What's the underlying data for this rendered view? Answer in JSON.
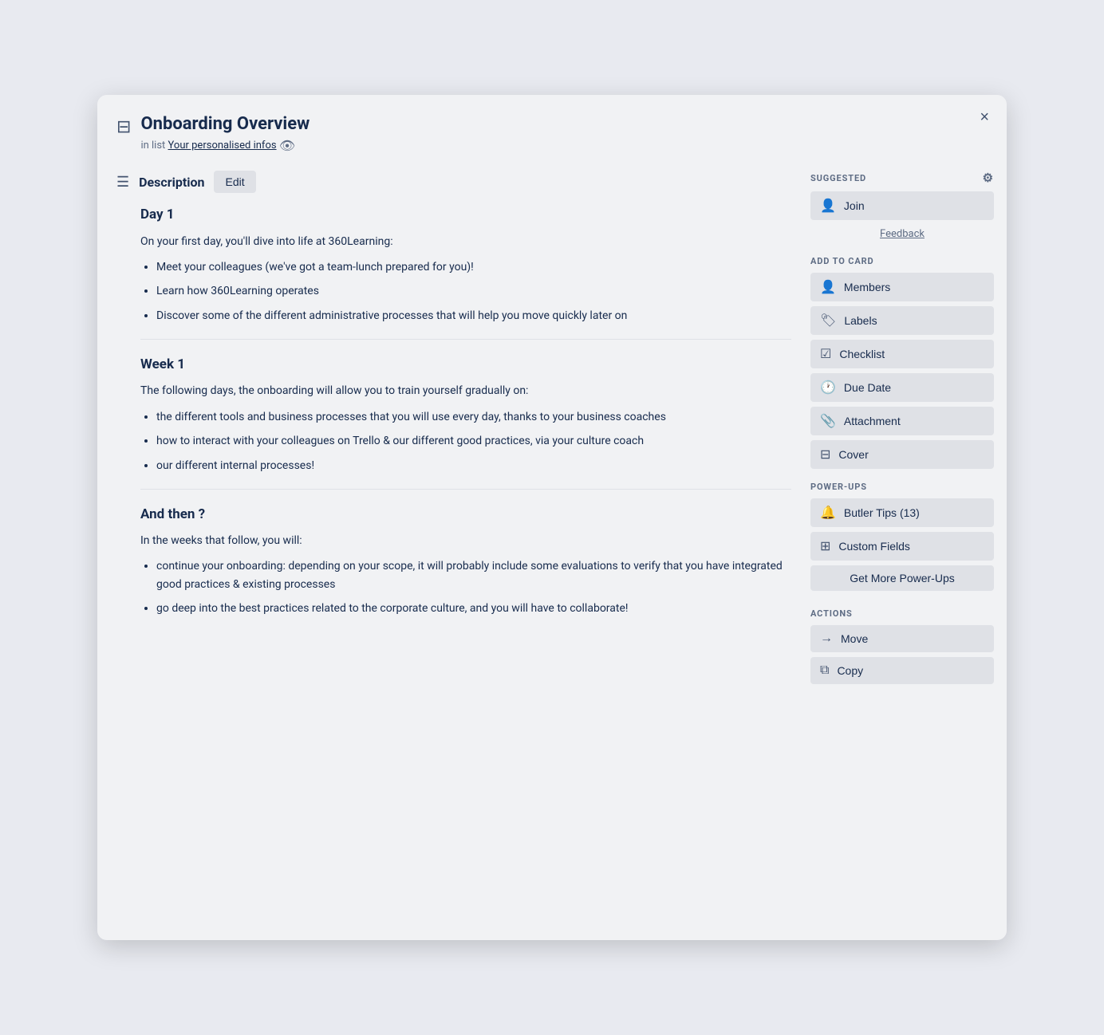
{
  "modal": {
    "title": "Onboarding Overview",
    "subtitle_prefix": "in list",
    "subtitle_link": "Your personalised infos",
    "close_label": "×"
  },
  "description": {
    "heading": "Description",
    "edit_label": "Edit",
    "sections": [
      {
        "id": "day1",
        "heading": "Day 1",
        "intro": "On your first day, you'll dive into life at 360Learning:",
        "bullets": [
          "Meet your colleagues (we've got a team-lunch prepared for you)!",
          "Learn how 360Learning operates",
          "Discover some of the different administrative processes that will help you move quickly later on"
        ]
      },
      {
        "id": "week1",
        "heading": "Week 1",
        "intro": "The following days, the onboarding will allow you to train yourself gradually on:",
        "bullets": [
          "the different tools and business processes that you will use every day, thanks to your business coaches",
          "how to interact with your colleagues on Trello & our different good practices, via your culture coach",
          "our different internal processes!"
        ]
      },
      {
        "id": "and_then",
        "heading": "And then ?",
        "intro": "In the weeks that follow, you will:",
        "bullets": [
          "continue your onboarding: depending on your scope, it will probably include some evaluations to verify that you have integrated good practices & existing processes",
          "go deep into the best practices related to the corporate culture, and you will have to collaborate!"
        ]
      }
    ]
  },
  "sidebar": {
    "suggested_label": "SUGGESTED",
    "add_to_card_label": "ADD TO CARD",
    "power_ups_label": "POWER-UPS",
    "actions_label": "ACTIONS",
    "join_label": "Join",
    "feedback_label": "Feedback",
    "members_label": "Members",
    "labels_label": "Labels",
    "checklist_label": "Checklist",
    "due_date_label": "Due Date",
    "attachment_label": "Attachment",
    "cover_label": "Cover",
    "butler_tips_label": "Butler Tips (13)",
    "custom_fields_label": "Custom Fields",
    "get_more_label": "Get More Power-Ups",
    "move_label": "Move",
    "copy_label": "Copy"
  }
}
